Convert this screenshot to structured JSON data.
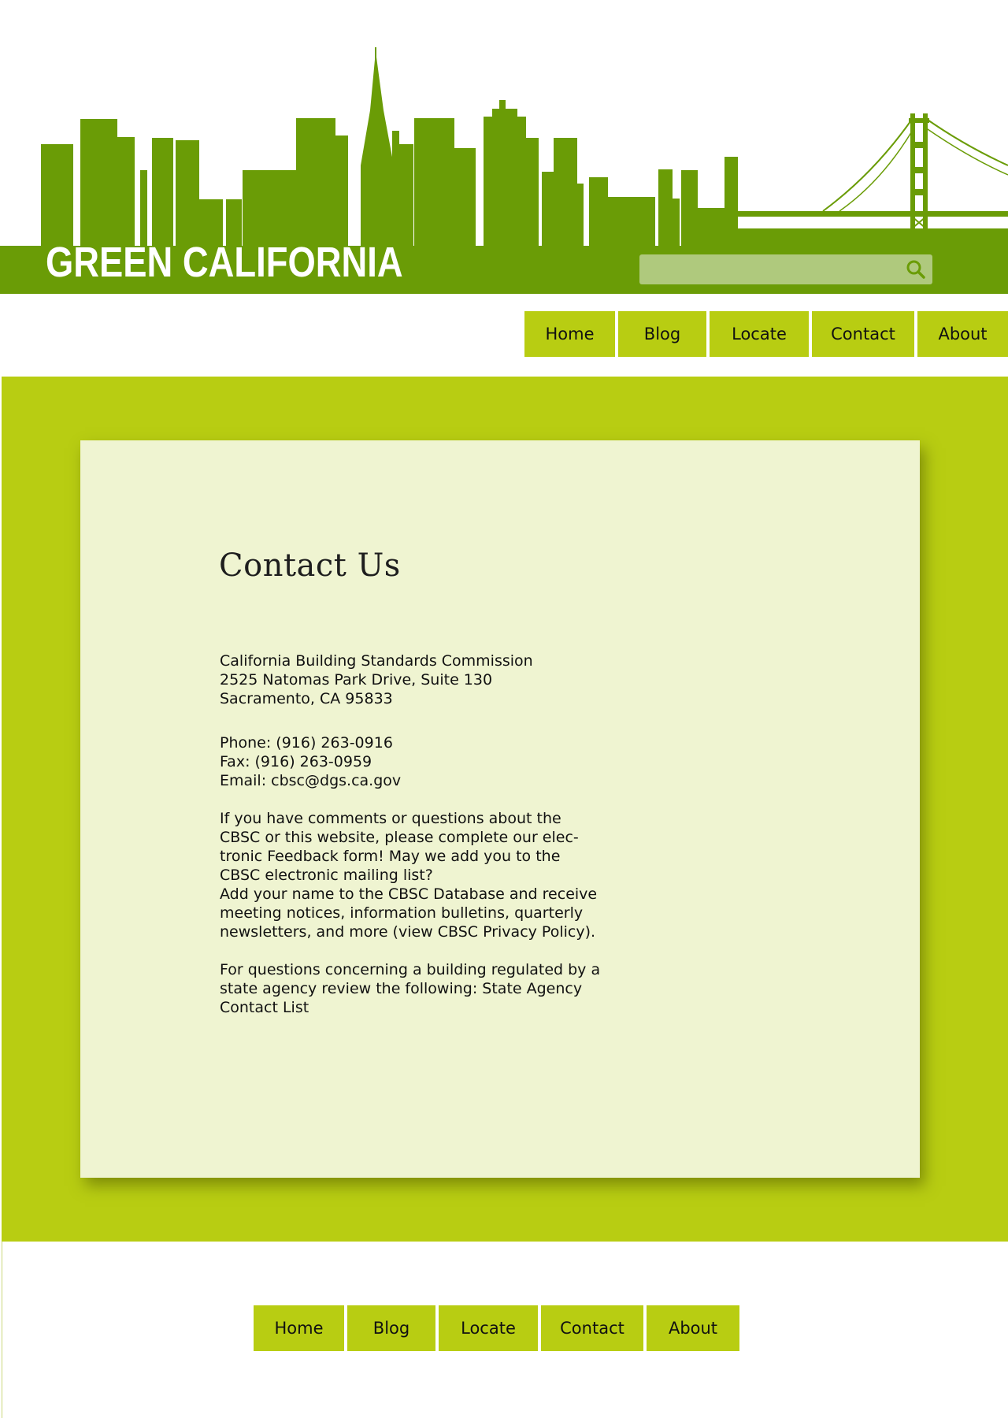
{
  "header": {
    "title": "GREEN CALIFORNIA",
    "search": {
      "value": "",
      "placeholder": "",
      "icon": "search-icon"
    },
    "colors": {
      "skyline": "#6a9c06",
      "search_bg": "#afc97d"
    }
  },
  "top_nav": {
    "items": [
      {
        "label": "Home"
      },
      {
        "label": "Blog"
      },
      {
        "label": "Locate"
      },
      {
        "label": "Contact"
      },
      {
        "label": "About"
      }
    ]
  },
  "main": {
    "heading": "Contact Us",
    "address": {
      "line1": "California Building Standards Commission",
      "line2": "2525 Natomas Park Drive, Suite 130",
      "line3": "Sacramento, CA 95833"
    },
    "contact": {
      "phone": "Phone: (916) 263-0916",
      "fax": "Fax: (916) 263-0959",
      "email": "Email: cbsc@dgs.ca.gov"
    },
    "feedback_paragraph": {
      "line1": "If you have comments or questions about the",
      "line2": "CBSC or this website, please complete our elec-",
      "line3": "tronic Feedback form!  May we add you to the",
      "line4": "CBSC electronic mailing list?",
      "line5": "Add your name to the CBSC Database and receive",
      "line6": "meeting notices, information bulletins, quarterly",
      "line7": "newsletters, and more (view CBSC Privacy Policy)."
    },
    "agency_paragraph": {
      "line1": "For questions concerning a building regulated by a",
      "line2": "state agency review the following: State Agency",
      "line3": "Contact List"
    },
    "colors": {
      "band": "#b8cd12",
      "card": "#eff4d1"
    }
  },
  "bottom_nav": {
    "items": [
      {
        "label": "Home"
      },
      {
        "label": "Blog"
      },
      {
        "label": "Locate"
      },
      {
        "label": "Contact"
      },
      {
        "label": "About"
      }
    ]
  }
}
